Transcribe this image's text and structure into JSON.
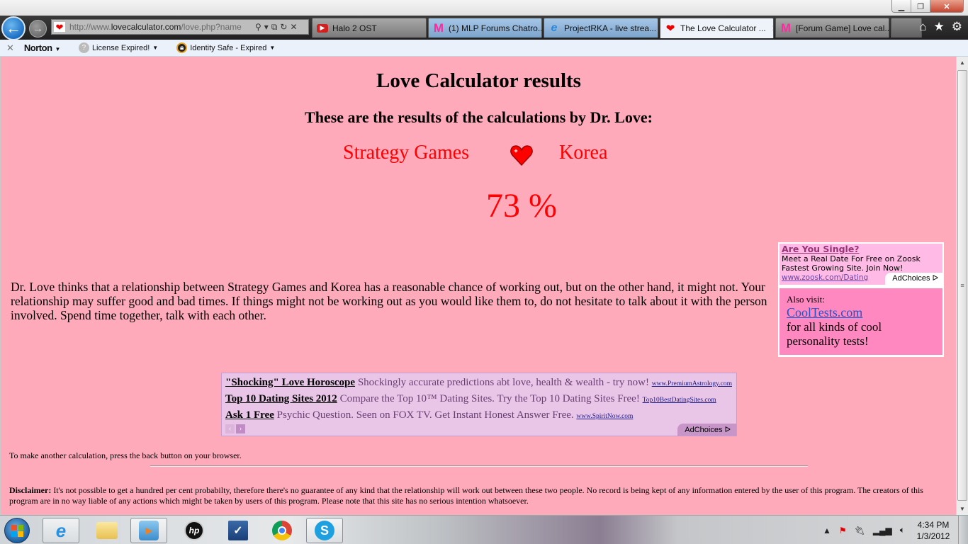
{
  "browser": {
    "address_url_prefix": "http://www.",
    "address_url_domain": "lovecalculator.com",
    "address_url_path": "/love.php?name",
    "tabs": [
      {
        "label": "Halo 2 OST",
        "icon": "youtube-icon",
        "state": "inactive"
      },
      {
        "label": "(1) MLP Forums Chatro...",
        "icon": "mlp-forums-icon",
        "state": "inactive"
      },
      {
        "label": "ProjectRKA - live strea...",
        "icon": "ie-icon",
        "state": "inactive"
      },
      {
        "label": "The Love Calculator ...",
        "icon": "heart-icon",
        "state": "active"
      },
      {
        "label": "[Forum Game] Love cal...",
        "icon": "mlp-forums-icon",
        "state": "inactive"
      }
    ],
    "toolbar": {
      "norton_label": "Norton",
      "license_label": "License Expired!",
      "identity_label": "Identity Safe - Expired"
    }
  },
  "page": {
    "title": "Love Calculator results",
    "subtitle": "These are the results of the calculations by Dr. Love:",
    "name1": "Strategy Games",
    "name2": "Korea",
    "percent_text": "73 %",
    "match_percent": 73,
    "description": "Dr. Love thinks that a relationship between Strategy Games and Korea has a reasonable chance of working out, but on the other hand, it might not. Your relationship may suffer good and bad times. If things might not be working out as you would like them to, do not hesitate to talk about it with the person involved. Spend time together, talk with each other.",
    "side_ad": {
      "title": "Are You Single?",
      "line1": "Meet a Real Date For Free on Zoosk",
      "line2": "Fastest Growing Site. Join Now!",
      "url": "www.zoosk.com/Dating",
      "adchoices": "AdChoices"
    },
    "promo": {
      "also_visit": "Also visit:",
      "link": "CoolTests.com",
      "text": "for all kinds of cool personality tests!"
    },
    "bottom_ads": [
      {
        "title": "\"Shocking\" Love Horoscope",
        "text": "Shockingly accurate predictions abt love, health & wealth - try now!",
        "url": "www.PremiumAstrology.com"
      },
      {
        "title": "Top 10 Dating Sites 2012",
        "text": "Compare the Top 10™ Dating Sites. Try the Top 10 Dating Sites Free!",
        "url": "Top10BestDatingSites.com"
      },
      {
        "title": "Ask 1 Free",
        "text": "Psychic Question. Seen on FOX TV. Get Instant Honest Answer Free.",
        "url": "www.SpiritNow.com"
      }
    ],
    "bottom_adchoices": "AdChoices",
    "again_text": "To make another calculation, press the back button on your browser.",
    "disclaimer_label": "Disclaimer:",
    "disclaimer_text": "It's not possible to get a hundred per cent probabilty, therefore there's no guarantee of any kind that the relationship will work out between these two people. No record is being kept of any information entered by the user of this program. The creators of this program are in no way liable of any actions which might be taken by users of this program. Please note that this site has no serious intention whatsoever."
  },
  "taskbar": {
    "apps": [
      "internet-explorer",
      "windows-explorer",
      "windows-media-player",
      "hp",
      "app-checkmark",
      "google-chrome",
      "skype"
    ],
    "clock_time": "4:34 PM",
    "clock_date": "1/3/2012"
  }
}
